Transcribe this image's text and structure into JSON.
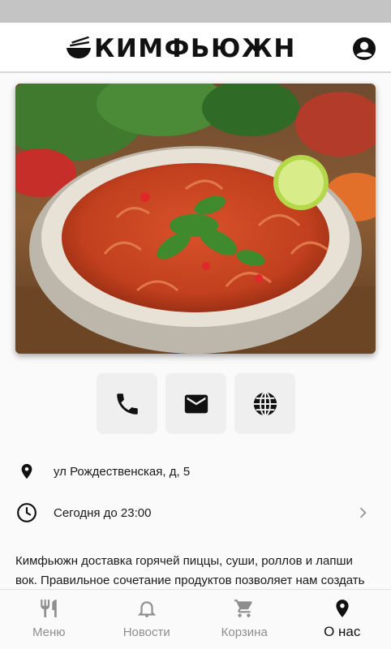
{
  "header": {
    "brand": "КИМФЬЮЖН"
  },
  "hero": {
    "image": "soup-with-shrimp-photo"
  },
  "actions": [
    {
      "name": "call-button",
      "icon": "phone-icon"
    },
    {
      "name": "email-button",
      "icon": "email-icon"
    },
    {
      "name": "website-button",
      "icon": "globe-icon"
    }
  ],
  "info": {
    "address": "ул Рождественская, д, 5",
    "hours": "Сегодня до 23:00"
  },
  "description": "Кимфьюжн доставка горячей пиццы, суши, роллов и лапши вок. Правильное сочетание продуктов позволяет нам создать",
  "tabs": [
    {
      "label": "Меню",
      "icon": "fork-knife-icon"
    },
    {
      "label": "Новости",
      "icon": "bell-icon"
    },
    {
      "label": "Корзина",
      "icon": "cart-icon"
    },
    {
      "label": "О нас",
      "icon": "location-pin-icon",
      "active": true
    }
  ],
  "colors": {
    "active": "#111111",
    "inactive": "#8e8e8e",
    "button_bg": "#efefef",
    "status_bar": "#c4c4c4"
  }
}
